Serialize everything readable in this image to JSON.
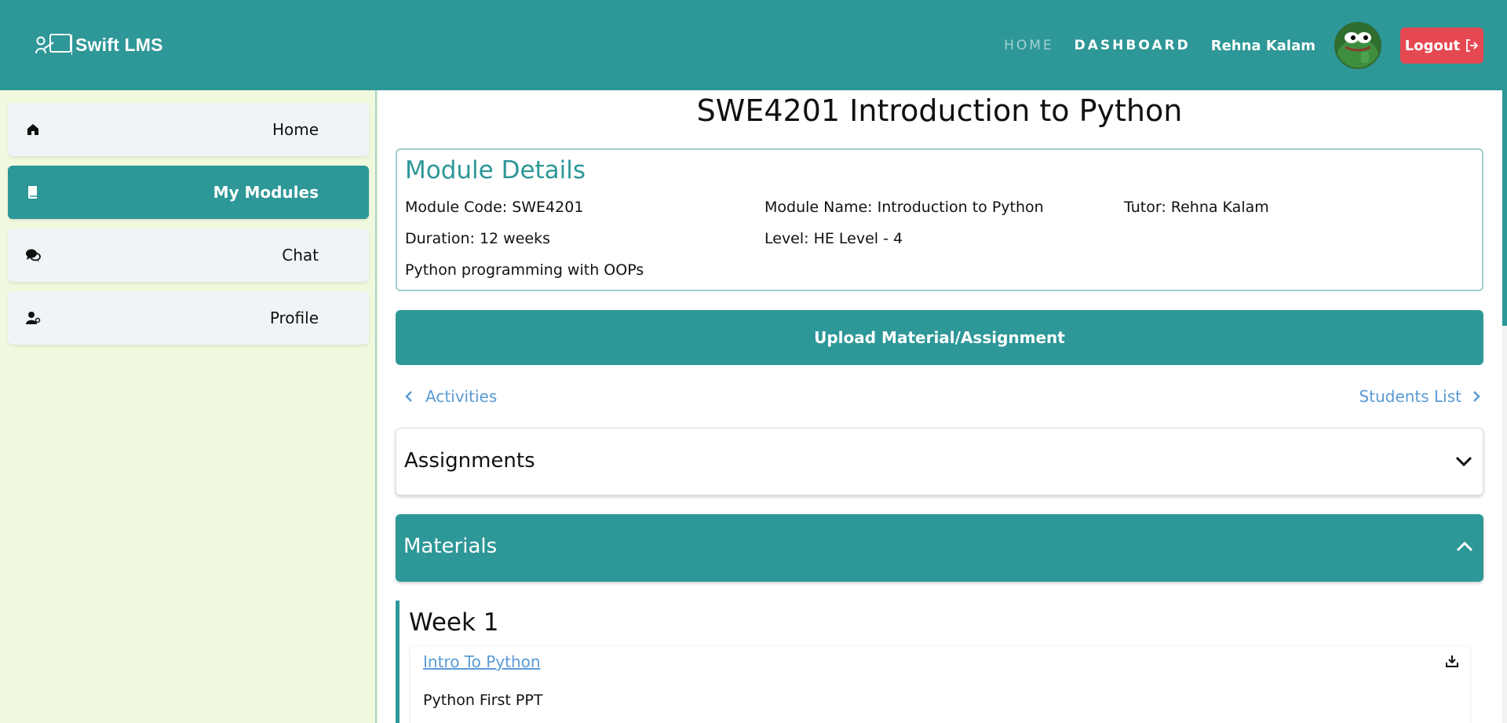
{
  "header": {
    "brand": "Swift LMS",
    "nav": {
      "home": "HOME",
      "dashboard": "DASHBOARD"
    },
    "user_name": "Rehna Kalam",
    "logout_label": "Logout"
  },
  "sidebar": {
    "items": [
      {
        "label": "Home",
        "icon": "home-icon"
      },
      {
        "label": "My Modules",
        "icon": "book-icon",
        "active": true
      },
      {
        "label": "Chat",
        "icon": "chat-icon"
      },
      {
        "label": "Profile",
        "icon": "user-gear-icon"
      }
    ]
  },
  "main": {
    "page_title": "SWE4201 Introduction to Python",
    "details": {
      "title": "Module Details",
      "code": "Module Code: SWE4201",
      "name": "Module Name: Introduction to Python",
      "tutor": "Tutor: Rehna Kalam",
      "duration": "Duration: 12 weeks",
      "level": "Level: HE Level - 4",
      "description": "Python programming with OOPs"
    },
    "upload_label": "Upload Material/Assignment",
    "pager": {
      "prev": "Activities",
      "next": "Students List"
    },
    "sections": {
      "assignments": "Assignments",
      "materials": "Materials"
    },
    "week": {
      "title": "Week 1",
      "material_link": "Intro To Python",
      "material_desc": "Python First PPT"
    }
  },
  "colors": {
    "teal": "#2e9797",
    "logout_red": "#e64852",
    "link_blue": "#5a9bd6",
    "sidebar_bg": "#f0f9dd"
  }
}
